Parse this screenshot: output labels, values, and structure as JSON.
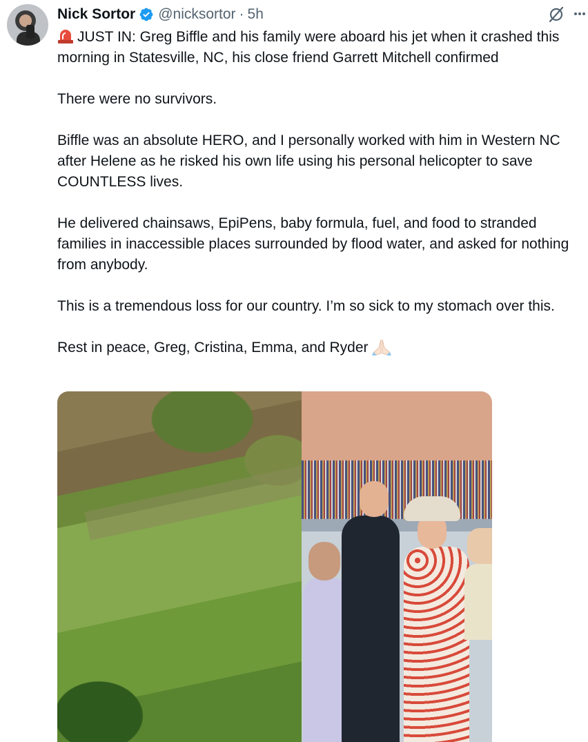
{
  "author": {
    "name": "Nick Sortor",
    "handle": "@nicksortor",
    "separator": "·",
    "time": "5h",
    "verified": true,
    "verified_color": "#1d9bf0"
  },
  "tweet": {
    "paragraphs": [
      "JUST IN: Greg Biffle and his family were aboard his jet when it crashed this morning in Statesville, NC, his close friend Garrett Mitchell confirmed",
      "There were no survivors.",
      "Biffle was an absolute HERO, and I personally worked with him in Western NC after Helene as he risked his own life using his personal helicopter to save COUNTLESS lives.",
      "He delivered chainsaws, EpiPens, baby formula, fuel, and food to stranded families in inaccessible places surrounded by flood water, and asked for nothing from anybody.",
      "This is a tremendous loss for our country. I’m so sick to my stomach over this.",
      "Rest in peace, Greg, Cristina, Emma, and Ryder"
    ],
    "leading_emoji": "siren-icon",
    "trailing_emoji": "folded-hands-icon"
  },
  "icons": {
    "grok": "grok-icon",
    "more": "more-icon"
  },
  "colors": {
    "text": "#0f1419",
    "secondary": "#536471",
    "verified": "#1d9bf0"
  }
}
